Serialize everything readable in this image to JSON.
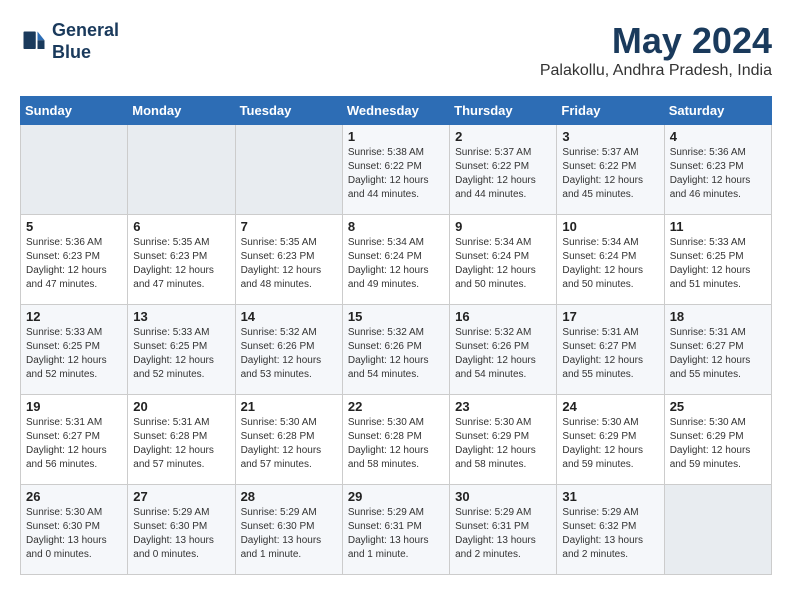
{
  "logo": {
    "line1": "General",
    "line2": "Blue"
  },
  "title": "May 2024",
  "location": "Palakollu, Andhra Pradesh, India",
  "days_of_week": [
    "Sunday",
    "Monday",
    "Tuesday",
    "Wednesday",
    "Thursday",
    "Friday",
    "Saturday"
  ],
  "weeks": [
    [
      {
        "day": "",
        "info": ""
      },
      {
        "day": "",
        "info": ""
      },
      {
        "day": "",
        "info": ""
      },
      {
        "day": "1",
        "info": "Sunrise: 5:38 AM\nSunset: 6:22 PM\nDaylight: 12 hours\nand 44 minutes."
      },
      {
        "day": "2",
        "info": "Sunrise: 5:37 AM\nSunset: 6:22 PM\nDaylight: 12 hours\nand 44 minutes."
      },
      {
        "day": "3",
        "info": "Sunrise: 5:37 AM\nSunset: 6:22 PM\nDaylight: 12 hours\nand 45 minutes."
      },
      {
        "day": "4",
        "info": "Sunrise: 5:36 AM\nSunset: 6:23 PM\nDaylight: 12 hours\nand 46 minutes."
      }
    ],
    [
      {
        "day": "5",
        "info": "Sunrise: 5:36 AM\nSunset: 6:23 PM\nDaylight: 12 hours\nand 47 minutes."
      },
      {
        "day": "6",
        "info": "Sunrise: 5:35 AM\nSunset: 6:23 PM\nDaylight: 12 hours\nand 47 minutes."
      },
      {
        "day": "7",
        "info": "Sunrise: 5:35 AM\nSunset: 6:23 PM\nDaylight: 12 hours\nand 48 minutes."
      },
      {
        "day": "8",
        "info": "Sunrise: 5:34 AM\nSunset: 6:24 PM\nDaylight: 12 hours\nand 49 minutes."
      },
      {
        "day": "9",
        "info": "Sunrise: 5:34 AM\nSunset: 6:24 PM\nDaylight: 12 hours\nand 50 minutes."
      },
      {
        "day": "10",
        "info": "Sunrise: 5:34 AM\nSunset: 6:24 PM\nDaylight: 12 hours\nand 50 minutes."
      },
      {
        "day": "11",
        "info": "Sunrise: 5:33 AM\nSunset: 6:25 PM\nDaylight: 12 hours\nand 51 minutes."
      }
    ],
    [
      {
        "day": "12",
        "info": "Sunrise: 5:33 AM\nSunset: 6:25 PM\nDaylight: 12 hours\nand 52 minutes."
      },
      {
        "day": "13",
        "info": "Sunrise: 5:33 AM\nSunset: 6:25 PM\nDaylight: 12 hours\nand 52 minutes."
      },
      {
        "day": "14",
        "info": "Sunrise: 5:32 AM\nSunset: 6:26 PM\nDaylight: 12 hours\nand 53 minutes."
      },
      {
        "day": "15",
        "info": "Sunrise: 5:32 AM\nSunset: 6:26 PM\nDaylight: 12 hours\nand 54 minutes."
      },
      {
        "day": "16",
        "info": "Sunrise: 5:32 AM\nSunset: 6:26 PM\nDaylight: 12 hours\nand 54 minutes."
      },
      {
        "day": "17",
        "info": "Sunrise: 5:31 AM\nSunset: 6:27 PM\nDaylight: 12 hours\nand 55 minutes."
      },
      {
        "day": "18",
        "info": "Sunrise: 5:31 AM\nSunset: 6:27 PM\nDaylight: 12 hours\nand 55 minutes."
      }
    ],
    [
      {
        "day": "19",
        "info": "Sunrise: 5:31 AM\nSunset: 6:27 PM\nDaylight: 12 hours\nand 56 minutes."
      },
      {
        "day": "20",
        "info": "Sunrise: 5:31 AM\nSunset: 6:28 PM\nDaylight: 12 hours\nand 57 minutes."
      },
      {
        "day": "21",
        "info": "Sunrise: 5:30 AM\nSunset: 6:28 PM\nDaylight: 12 hours\nand 57 minutes."
      },
      {
        "day": "22",
        "info": "Sunrise: 5:30 AM\nSunset: 6:28 PM\nDaylight: 12 hours\nand 58 minutes."
      },
      {
        "day": "23",
        "info": "Sunrise: 5:30 AM\nSunset: 6:29 PM\nDaylight: 12 hours\nand 58 minutes."
      },
      {
        "day": "24",
        "info": "Sunrise: 5:30 AM\nSunset: 6:29 PM\nDaylight: 12 hours\nand 59 minutes."
      },
      {
        "day": "25",
        "info": "Sunrise: 5:30 AM\nSunset: 6:29 PM\nDaylight: 12 hours\nand 59 minutes."
      }
    ],
    [
      {
        "day": "26",
        "info": "Sunrise: 5:30 AM\nSunset: 6:30 PM\nDaylight: 13 hours\nand 0 minutes."
      },
      {
        "day": "27",
        "info": "Sunrise: 5:29 AM\nSunset: 6:30 PM\nDaylight: 13 hours\nand 0 minutes."
      },
      {
        "day": "28",
        "info": "Sunrise: 5:29 AM\nSunset: 6:30 PM\nDaylight: 13 hours\nand 1 minute."
      },
      {
        "day": "29",
        "info": "Sunrise: 5:29 AM\nSunset: 6:31 PM\nDaylight: 13 hours\nand 1 minute."
      },
      {
        "day": "30",
        "info": "Sunrise: 5:29 AM\nSunset: 6:31 PM\nDaylight: 13 hours\nand 2 minutes."
      },
      {
        "day": "31",
        "info": "Sunrise: 5:29 AM\nSunset: 6:32 PM\nDaylight: 13 hours\nand 2 minutes."
      },
      {
        "day": "",
        "info": ""
      }
    ]
  ]
}
